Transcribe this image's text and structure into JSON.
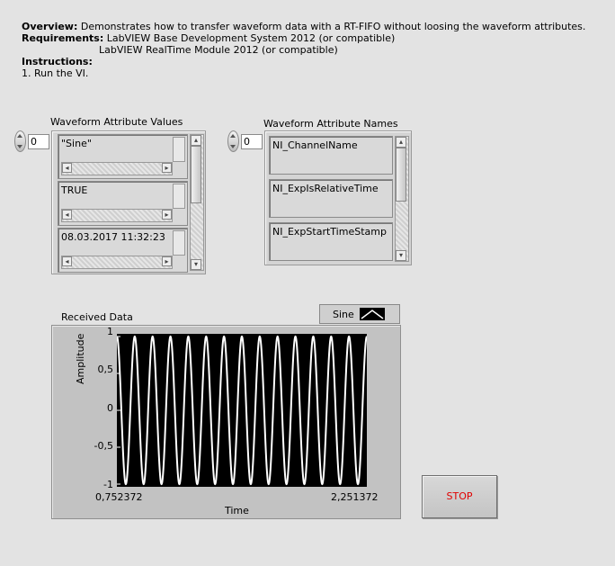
{
  "description": {
    "overview_label": "Overview:",
    "overview_text": "Demonstrates how to transfer waveform data with a RT-FIFO without loosing the waveform attributes.",
    "requirements_label": "Requirements:",
    "requirements_line1": "LabVIEW Base Development System 2012 (or compatible)",
    "requirements_line2": "LabVIEW RealTime Module 2012 (or compatible)",
    "instructions_label": "Instructions:",
    "instructions_step1": "1. Run the VI."
  },
  "attr_values": {
    "label": "Waveform Attribute Values",
    "index": "0",
    "items": [
      "\"Sine\"",
      "TRUE",
      "08.03.2017 11:32:23"
    ]
  },
  "attr_names": {
    "label": "Waveform Attribute Names",
    "index": "0",
    "items": [
      "NI_ChannelName",
      "NI_ExpIsRelativeTime",
      "NI_ExpStartTimeStamp"
    ]
  },
  "chart_data": {
    "type": "line",
    "title": "Received Data",
    "xlabel": "Time",
    "ylabel": "Amplitude",
    "x_range": [
      0.752372,
      2.251372
    ],
    "x_tick_labels": [
      "0,752372",
      "2,251372"
    ],
    "ylim": [
      -1,
      1
    ],
    "y_ticks": [
      1,
      0.5,
      0,
      -0.5,
      -1
    ],
    "y_tick_labels": [
      "1",
      "0,5",
      "0",
      "-0,5",
      "-1"
    ],
    "series": [
      {
        "name": "Sine",
        "function": "sine",
        "amplitude": 1,
        "cycles": 14,
        "color": "#ffffff"
      }
    ],
    "plot_background": "#000000",
    "grid": false,
    "legend_position": "top-right"
  },
  "stop_button": {
    "label": "STOP",
    "color": "#e00000"
  }
}
